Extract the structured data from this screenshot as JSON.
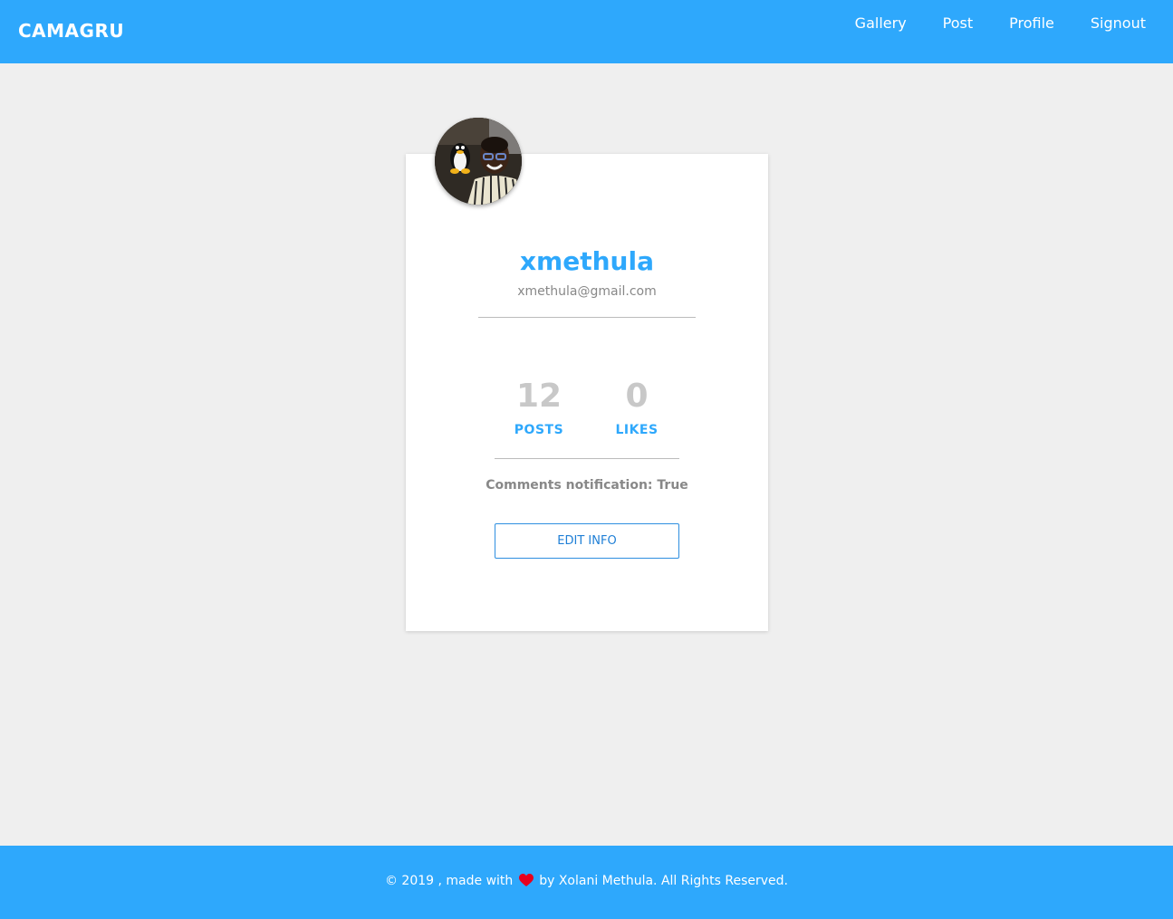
{
  "navbar": {
    "brand": "CAMAGRU",
    "links": [
      {
        "label": "Gallery"
      },
      {
        "label": "Post"
      },
      {
        "label": "Profile"
      },
      {
        "label": "Signout"
      }
    ]
  },
  "profile": {
    "username": "xmethula",
    "email": "xmethula@gmail.com",
    "stats": [
      {
        "value": "12",
        "label": "POSTS"
      },
      {
        "value": "0",
        "label": "LIKES"
      }
    ],
    "notification_text": "Comments notification: True",
    "edit_button_label": "EDIT INFO"
  },
  "footer": {
    "text_before_heart": "© 2019 , made with",
    "heart_icon": "heart-icon",
    "text_after_heart": "by Xolani Methula. All Rights Reserved."
  },
  "colors": {
    "accent": "#2ea8fc",
    "page_background": "#efefef",
    "heart": "#e8001c"
  }
}
